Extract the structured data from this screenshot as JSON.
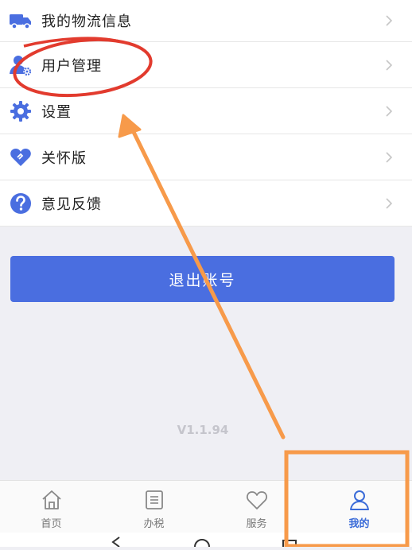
{
  "menu": {
    "items": [
      {
        "label": "我的物流信息",
        "icon": "truck-icon"
      },
      {
        "label": "用户管理",
        "icon": "user-settings-icon"
      },
      {
        "label": "设置",
        "icon": "gear-icon"
      },
      {
        "label": "关怀版",
        "icon": "heart-icon"
      },
      {
        "label": "意见反馈",
        "icon": "question-icon"
      }
    ]
  },
  "logout_label": "退出账号",
  "version": "V1.1.94",
  "tabs": [
    {
      "label": "首页",
      "icon": "home-icon"
    },
    {
      "label": "办税",
      "icon": "list-icon"
    },
    {
      "label": "服务",
      "icon": "heart-outline-icon"
    },
    {
      "label": "我的",
      "icon": "person-icon",
      "active": true
    }
  ],
  "colors": {
    "accent": "#4a6ee0",
    "annotation_red": "#e23b2e",
    "annotation_orange": "#f79a4a"
  }
}
